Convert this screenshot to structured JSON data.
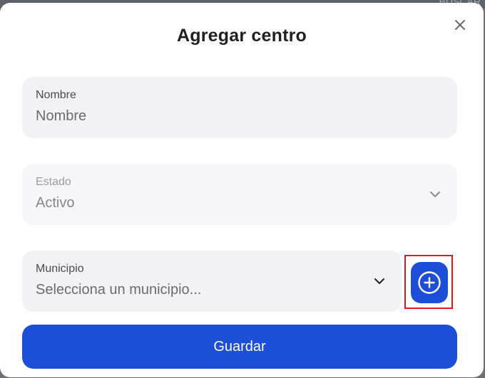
{
  "backdrop": {
    "text": "BUSCAR"
  },
  "modal": {
    "title": "Agregar centro",
    "close_icon": "close-icon"
  },
  "fields": {
    "nombre": {
      "label": "Nombre",
      "placeholder": "Nombre",
      "value": ""
    },
    "estado": {
      "label": "Estado",
      "value": "Activo",
      "disabled": true,
      "icon": "chevron-down-icon"
    },
    "municipio": {
      "label": "Municipio",
      "placeholder": "Selecciona un municipio...",
      "icon": "chevron-down-icon"
    }
  },
  "add_municipio_button": {
    "icon": "plus-circle-icon",
    "highlight_color": "#e3141e"
  },
  "save_button": {
    "label": "Guardar"
  },
  "colors": {
    "primary": "#1d4ed8",
    "field_bg": "#f2f2f4",
    "highlight": "#e3141e"
  }
}
